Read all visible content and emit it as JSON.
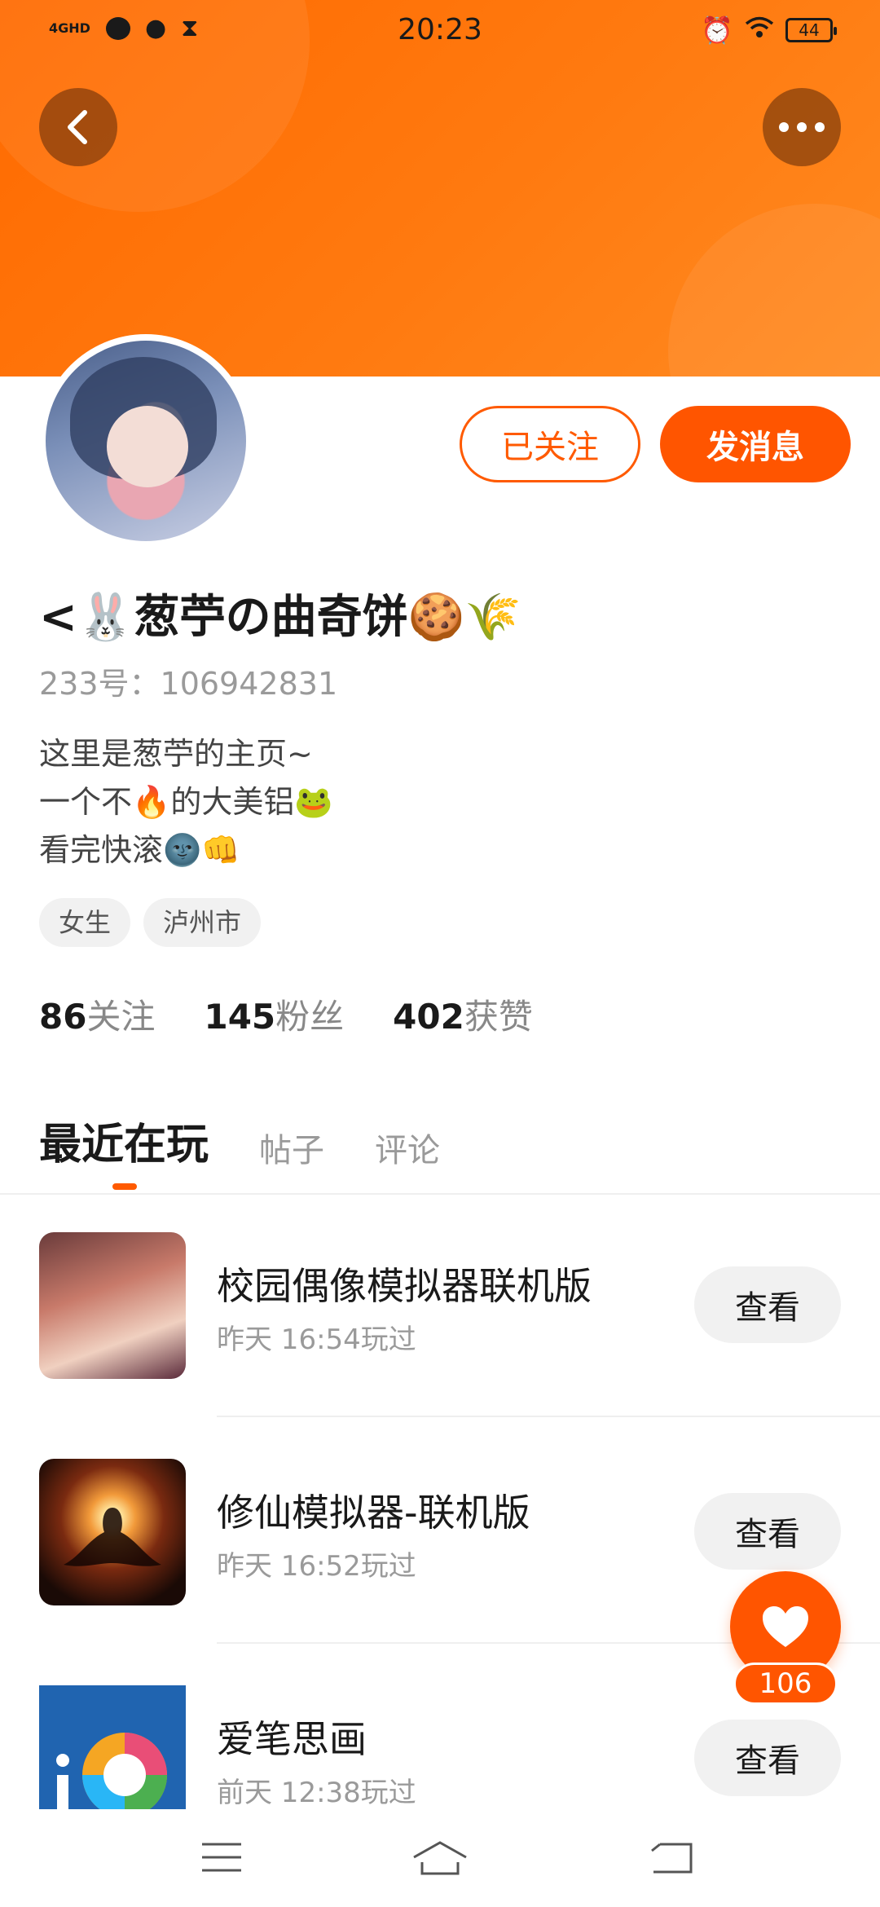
{
  "status_bar": {
    "network": "4GHD",
    "time": "20:23",
    "battery": "44",
    "icons": [
      "message-icon",
      "wechat-icon",
      "hourglass-icon",
      "alarm-icon",
      "wifi-icon",
      "battery-icon"
    ]
  },
  "header": {
    "back_icon": "chevron-left-icon",
    "more_icon": "more-horizontal-icon",
    "banner_color": "#ff6a00"
  },
  "profile": {
    "followed_label": "已关注",
    "message_label": "发消息",
    "name": "<🐰葱苧の曲奇饼🍪🌾",
    "uid": "233号：106942831",
    "bio": [
      "这里是葱苧的主页~",
      "一个不🔥的大美铝🐸",
      "看完快滚🌚👊"
    ],
    "tags": [
      "女生",
      "泸州市"
    ],
    "stats": [
      {
        "num": "86",
        "label": "关注"
      },
      {
        "num": "145",
        "label": "粉丝"
      },
      {
        "num": "402",
        "label": "获赞"
      }
    ]
  },
  "tabs": [
    "最近在玩",
    "帖子",
    "评论"
  ],
  "games": [
    {
      "title": "校园偶像模拟器联机版",
      "time": "昨天 16:54玩过",
      "action": "查看"
    },
    {
      "title": "修仙模拟器-联机版",
      "time": "昨天 16:52玩过",
      "action": "查看"
    },
    {
      "title": "爱笔思画",
      "time": "前天 12:38玩过",
      "action": "查看"
    }
  ],
  "like": {
    "count": "106",
    "icon": "heart-icon"
  },
  "accent_color": "#ff5500",
  "nav": [
    "menu-icon",
    "home-icon",
    "back-icon"
  ]
}
